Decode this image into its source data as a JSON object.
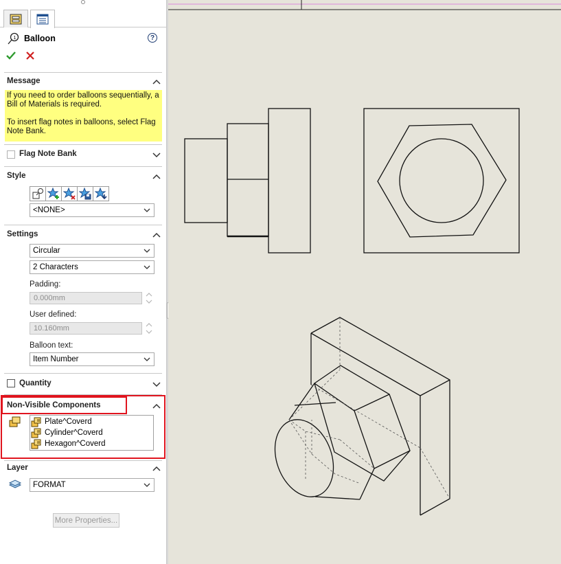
{
  "panel": {
    "title": "Balloon",
    "help_label": "?",
    "message": {
      "header": "Message",
      "line1": "If you need to order balloons sequentially, a Bill of Materials is required.",
      "line2": "To insert flag notes in balloons, select Flag Note Bank."
    },
    "flag_note_bank": {
      "label": "Flag Note Bank",
      "checked": false
    },
    "style": {
      "header": "Style",
      "selected": "<NONE>"
    },
    "settings": {
      "header": "Settings",
      "shape": "Circular",
      "size": "2 Characters",
      "padding_label": "Padding:",
      "padding_value": "0.000mm",
      "user_defined_label": "User defined:",
      "user_defined_value": "10.160mm",
      "balloon_text_label": "Balloon text:",
      "balloon_text_value": "Item Number"
    },
    "quantity": {
      "label": "Quantity",
      "checked": false
    },
    "non_visible": {
      "header": "Non-Visible Components",
      "items": [
        "Plate^Coverd",
        "Cylinder^Coverd",
        "Hexagon^Coverd"
      ]
    },
    "layer": {
      "header": "Layer",
      "value": "FORMAT"
    },
    "more_properties": "More Properties..."
  },
  "colors": {
    "message_bg": "#ffff80",
    "highlight_red": "#e0141e",
    "canvas_bg": "#e6e4da",
    "ok_green": "#2e9a2e",
    "cancel_red": "#d02020"
  }
}
